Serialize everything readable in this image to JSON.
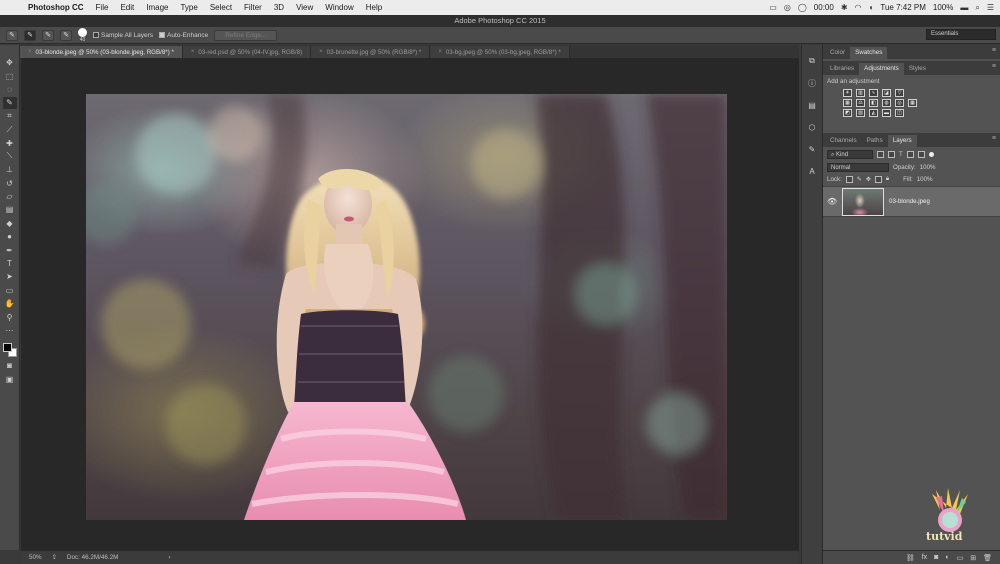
{
  "menubar": {
    "apple": "",
    "app_name": "Photoshop CC",
    "items": [
      "File",
      "Edit",
      "Image",
      "Type",
      "Select",
      "Filter",
      "3D",
      "View",
      "Window",
      "Help"
    ],
    "timer": "00:00",
    "clock": "Tue 7:42 PM",
    "battery": "100%"
  },
  "window": {
    "title": "Adobe Photoshop CC 2015"
  },
  "options": {
    "brush_size": "40",
    "sample_all_layers": "Sample All Layers",
    "auto_enhance": "Auto-Enhance",
    "refine_edge": "Refine Edge...",
    "workspace": "Essentials"
  },
  "tabs": [
    {
      "label": "03-blonde.jpeg @ 50% (03-blonde.jpeg, RGB/8*) *",
      "active": true
    },
    {
      "label": "03-red.psd @ 50% (04-IV.jpg, RGB/8)",
      "active": false
    },
    {
      "label": "03-brunette.jpg @ 50% (RGB/8*) *",
      "active": false
    },
    {
      "label": "03-bg.jpeg @ 50% (03-bg.jpeg, RGB/8*) *",
      "active": false
    }
  ],
  "status": {
    "zoom": "50%",
    "doc": "Doc: 46.2M/46.2M"
  },
  "panels": {
    "top_tabs": [
      "Color",
      "Swatches"
    ],
    "mid_tabs": [
      "Libraries",
      "Adjustments",
      "Styles"
    ],
    "adjustments_title": "Add an adjustment",
    "layer_tabs": [
      "Channels",
      "Paths",
      "Layers"
    ],
    "kind_label": "Kind",
    "blend_mode": "Normal",
    "opacity_label": "Opacity:",
    "opacity_value": "100%",
    "lock_label": "Lock:",
    "fill_label": "Fill:",
    "fill_value": "100%",
    "layer_name": "03-blonde.jpeg"
  },
  "watermark": {
    "text": "tutvid"
  }
}
